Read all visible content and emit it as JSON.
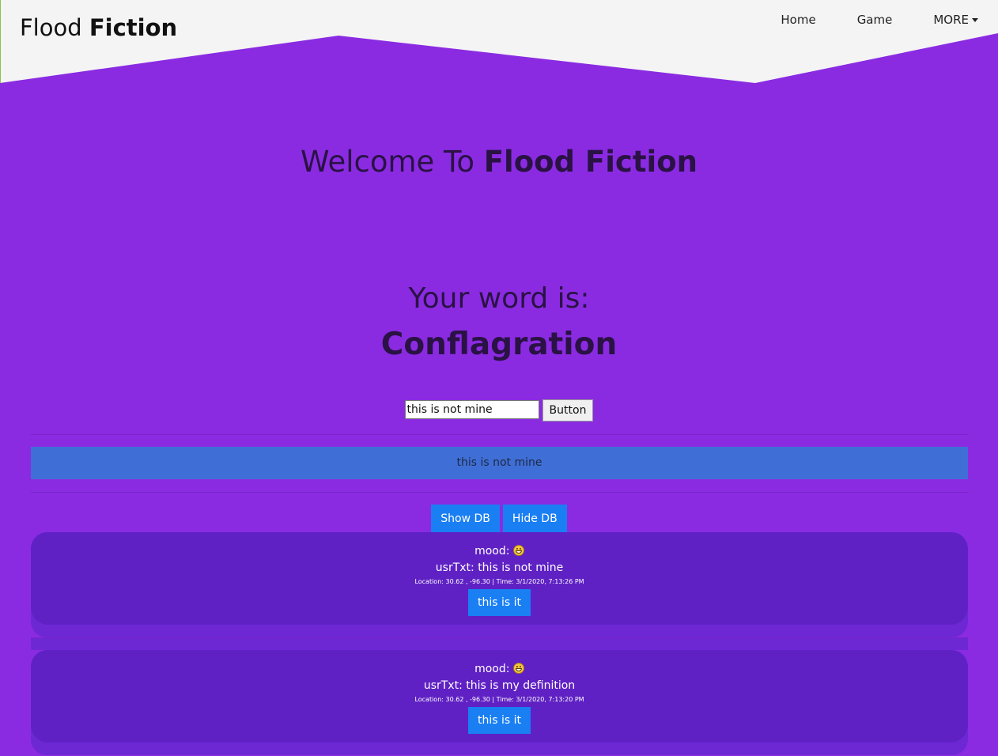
{
  "header": {
    "brand_light": "Flood",
    "brand_bold": "Fiction",
    "nav": {
      "home": "Home",
      "game": "Game",
      "more": "MORE"
    }
  },
  "main": {
    "welcome_prefix": "Welcome To",
    "welcome_bold": "Flood Fiction",
    "word_intro": "Your word is:",
    "word": "Conflagration",
    "input_value": "this is not mine",
    "submit_label": "Button",
    "output_text": "this is not mine",
    "show_db_label": "Show DB",
    "hide_db_label": "Hide DB"
  },
  "entries": [
    {
      "mood_label": "mood:",
      "mood_icon": "grin-emoji-icon",
      "usr_text": "usrTxt: this is not mine",
      "meta": "Location: 30.62 , -96.30 | Time: 3/1/2020, 7:13:26 PM",
      "button_label": "this is it"
    },
    {
      "mood_label": "mood:",
      "mood_icon": "grin-emoji-icon",
      "usr_text": "usrTxt: this is my definition",
      "meta": "Location: 30.62 , -96.30 | Time: 3/1/2020, 7:13:20 PM",
      "button_label": "this is it"
    }
  ],
  "colors": {
    "background": "#8a2be2",
    "header": "#f4f4f4",
    "output_bar": "#3f6fd6",
    "entry_card": "#5f21c4",
    "button_blue": "#1a7ff3"
  }
}
